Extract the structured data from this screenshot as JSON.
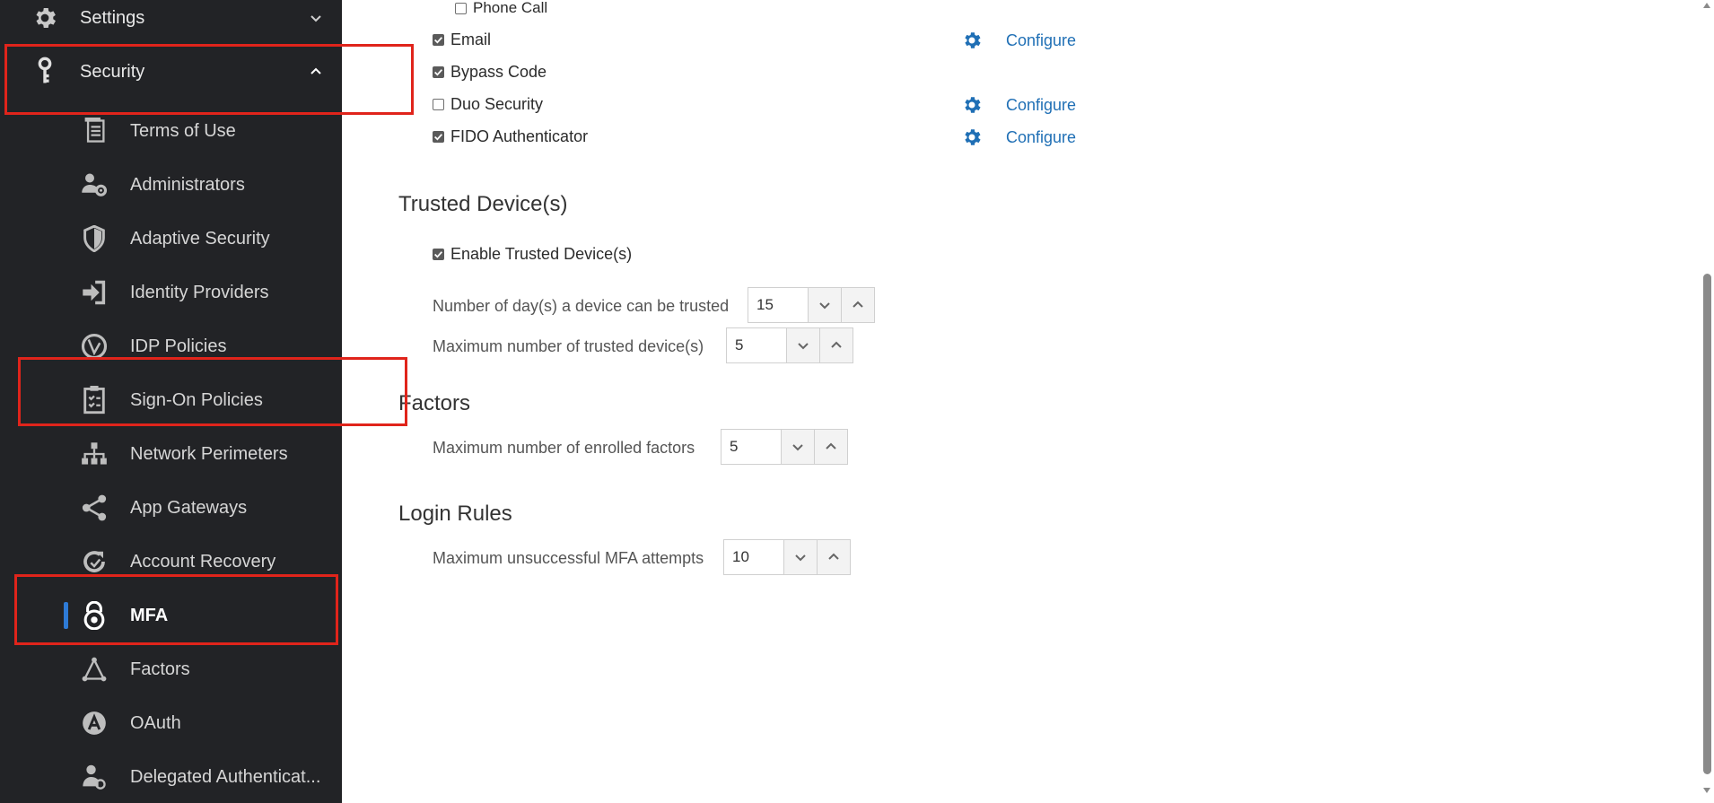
{
  "sidebar": {
    "settings": {
      "label": "Settings",
      "icon": "gear-icon"
    },
    "security": {
      "label": "Security",
      "icon": "key-icon"
    },
    "items": [
      {
        "label": "Terms of Use",
        "icon": "document-icon"
      },
      {
        "label": "Administrators",
        "icon": "admin-gear-icon"
      },
      {
        "label": "Adaptive Security",
        "icon": "shield-icon"
      },
      {
        "label": "Identity Providers",
        "icon": "sign-in-icon"
      },
      {
        "label": "IDP Policies",
        "icon": "idp-policy-icon"
      },
      {
        "label": "Sign-On Policies",
        "icon": "clipboard-check-icon"
      },
      {
        "label": "Network Perimeters",
        "icon": "network-icon"
      },
      {
        "label": "App Gateways",
        "icon": "share-icon"
      },
      {
        "label": "Account Recovery",
        "icon": "recovery-icon"
      },
      {
        "label": "MFA",
        "icon": "lock-icon",
        "active": true
      },
      {
        "label": "Factors",
        "icon": "triangle-nodes-icon"
      },
      {
        "label": "OAuth",
        "icon": "oauth-icon"
      },
      {
        "label": "Delegated Authenticat...",
        "icon": "delegated-auth-icon"
      }
    ]
  },
  "factors_list": [
    {
      "label": "Phone Call",
      "checked": false
    },
    {
      "label": "Email",
      "checked": true,
      "configure": "Configure"
    },
    {
      "label": "Bypass Code",
      "checked": true
    },
    {
      "label": "Duo Security",
      "checked": false,
      "configure": "Configure"
    },
    {
      "label": "FIDO Authenticator",
      "checked": true,
      "configure": "Configure"
    }
  ],
  "trusted": {
    "title": "Trusted Device(s)",
    "enable_label": "Enable Trusted Device(s)",
    "enable_checked": true,
    "days_label": "Number of day(s) a device can be trusted",
    "days_value": "15",
    "max_devices_label": "Maximum number of trusted device(s)",
    "max_devices_value": "5"
  },
  "factors_section": {
    "title": "Factors",
    "max_enrolled_label": "Maximum number of enrolled factors",
    "max_enrolled_value": "5"
  },
  "login_rules": {
    "title": "Login Rules",
    "max_attempts_label": "Maximum unsuccessful MFA attempts",
    "max_attempts_value": "10"
  },
  "colors": {
    "sidebar_bg": "#222326",
    "link": "#1f6fb5",
    "annotation": "#e0241b",
    "active_indicator": "#2e7bd6"
  }
}
